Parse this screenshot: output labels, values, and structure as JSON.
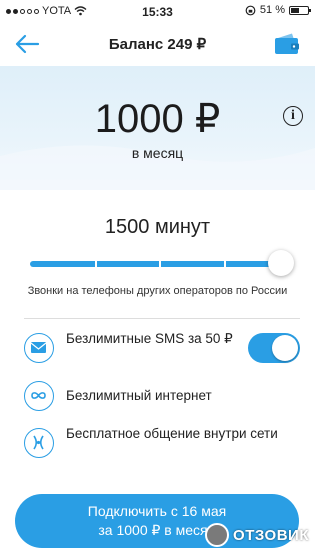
{
  "status_bar": {
    "carrier": "YOTA",
    "time": "15:33",
    "battery": "51 %",
    "battery_level": 0.51
  },
  "header": {
    "title": "Баланс 249 ₽",
    "back_icon": "back-arrow-icon",
    "wallet_icon": "wallet-icon"
  },
  "tariff": {
    "price": "1000 ₽",
    "period": "в месяц",
    "info_icon": "info-icon",
    "info_symbol": "i"
  },
  "minutes": {
    "label": "1500 минут",
    "segments": 4,
    "level": 1.0,
    "hint": "Звонки на телефоны других операторов по России"
  },
  "features": [
    {
      "label": "Безлимитные SMS за 50 ₽",
      "icon": "envelope-icon",
      "toggle_on": true
    },
    {
      "label": "Безлимитный интернет",
      "icon": "infinity-icon"
    },
    {
      "label": "Бесплатное общение внутри сети",
      "icon": "network-icon"
    }
  ],
  "cta": {
    "line1": "Подключить с 16 мая",
    "line2": "за 1000 ₽ в месяц"
  },
  "watermark": {
    "text": "ОТЗОВИК"
  },
  "colors": {
    "accent": "#2a9ee4"
  }
}
